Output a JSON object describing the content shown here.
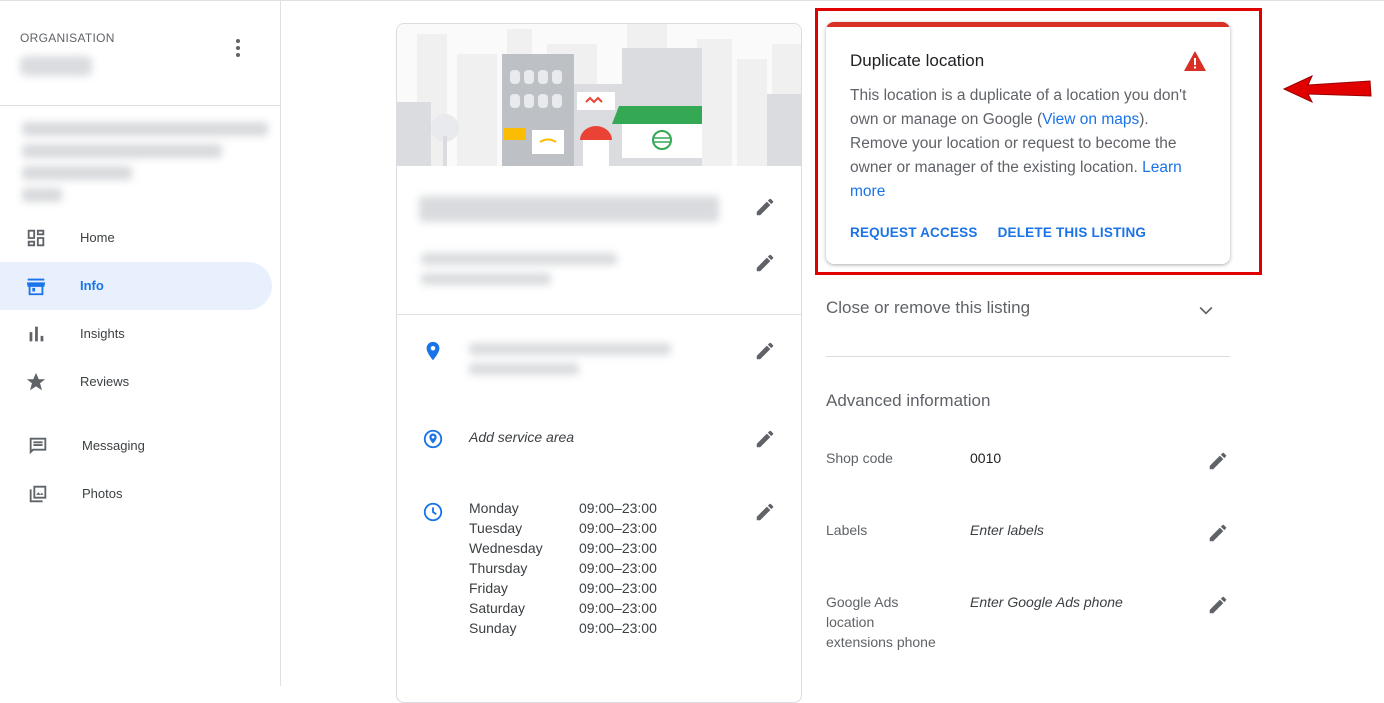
{
  "sidebar": {
    "org_label": "ORGANISATION",
    "nav": [
      {
        "label": "Home",
        "icon": "dashboard-icon"
      },
      {
        "label": "Info",
        "icon": "storefront-icon",
        "active": true
      },
      {
        "label": "Insights",
        "icon": "bar-chart-icon"
      },
      {
        "label": "Reviews",
        "icon": "star-icon"
      },
      {
        "label": "Messaging",
        "icon": "chat-icon"
      },
      {
        "label": "Photos",
        "icon": "photo-library-icon"
      }
    ]
  },
  "info": {
    "add_service_area": "Add service area",
    "hours": [
      {
        "day": "Monday",
        "time": "09:00–23:00"
      },
      {
        "day": "Tuesday",
        "time": "09:00–23:00"
      },
      {
        "day": "Wednesday",
        "time": "09:00–23:00"
      },
      {
        "day": "Thursday",
        "time": "09:00–23:00"
      },
      {
        "day": "Friday",
        "time": "09:00–23:00"
      },
      {
        "day": "Saturday",
        "time": "09:00–23:00"
      },
      {
        "day": "Sunday",
        "time": "09:00–23:00"
      }
    ]
  },
  "alert": {
    "title": "Duplicate location",
    "body_part1": "This location is a duplicate of a location you don't own or manage on Google (",
    "view_on_maps": "View on maps",
    "body_part2": "). Remove your location or request to become the owner or manager of the existing location.",
    "learn_more": "Learn more",
    "request_access": "REQUEST ACCESS",
    "delete_listing": "DELETE THIS LISTING",
    "accent_color": "#d93025"
  },
  "close_listing": "Close or remove this listing",
  "advanced": {
    "title": "Advanced information",
    "shop_code_label": "Shop code",
    "shop_code_value": "0010",
    "labels_label": "Labels",
    "labels_placeholder": "Enter labels",
    "ads_phone_label": "Google Ads location extensions phone",
    "ads_phone_placeholder": "Enter Google Ads phone"
  },
  "colors": {
    "accent": "#1a73e8",
    "annotation": "#e00000"
  }
}
